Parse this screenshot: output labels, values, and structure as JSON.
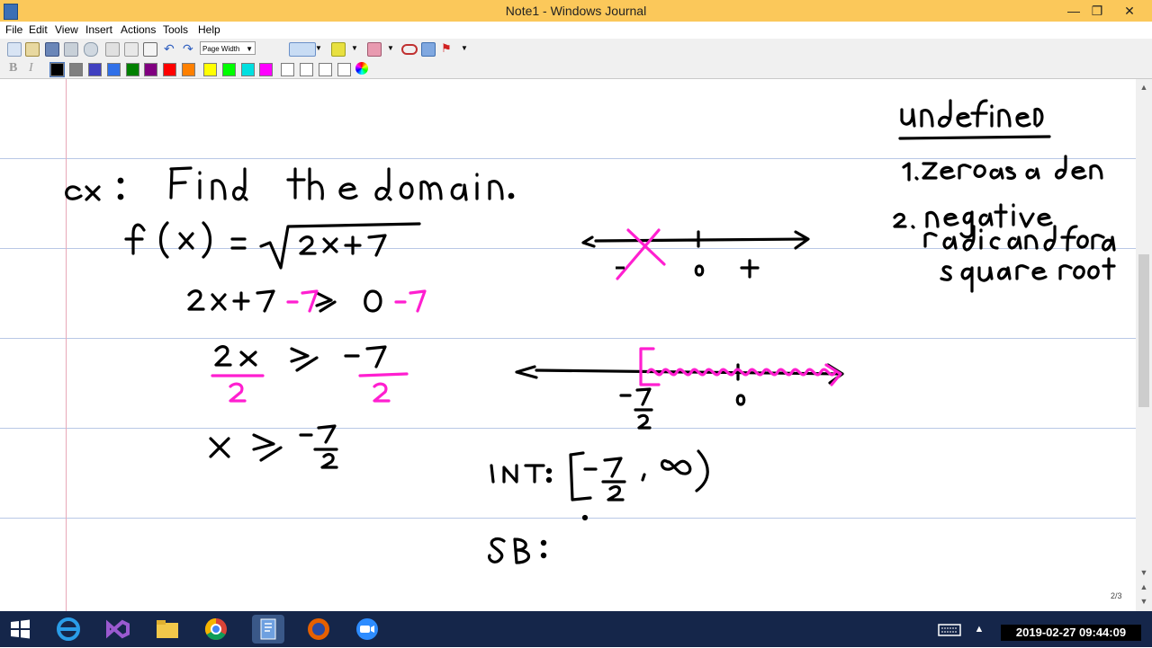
{
  "window": {
    "title": "Note1 - Windows Journal",
    "minimize": "—",
    "maximize": "❐",
    "close": "✕"
  },
  "menu": [
    "File",
    "Edit",
    "View",
    "Insert",
    "Actions",
    "Tools",
    "Help"
  ],
  "toolbar": {
    "zoom_select": "Page Width",
    "pen_colors": [
      "#000000",
      "#808080",
      "#4040c0",
      "#3070e8",
      "#008000",
      "#800080",
      "#ff0000",
      "#ff8000",
      "#ffff00",
      "#00ff00",
      "#00e0e0",
      "#ff00ff"
    ]
  },
  "page": {
    "indicator": "2/3"
  },
  "taskbar": {
    "clock_overlay": "2019-02-27 09:44:09"
  },
  "colors": {
    "titlebar": "#fbc85a",
    "ink_black": "#000000",
    "ink_magenta": "#ff1fd0",
    "rule_line": "#b9c8e6",
    "margin": "#e8a8b8",
    "taskbar": "#15264a"
  }
}
